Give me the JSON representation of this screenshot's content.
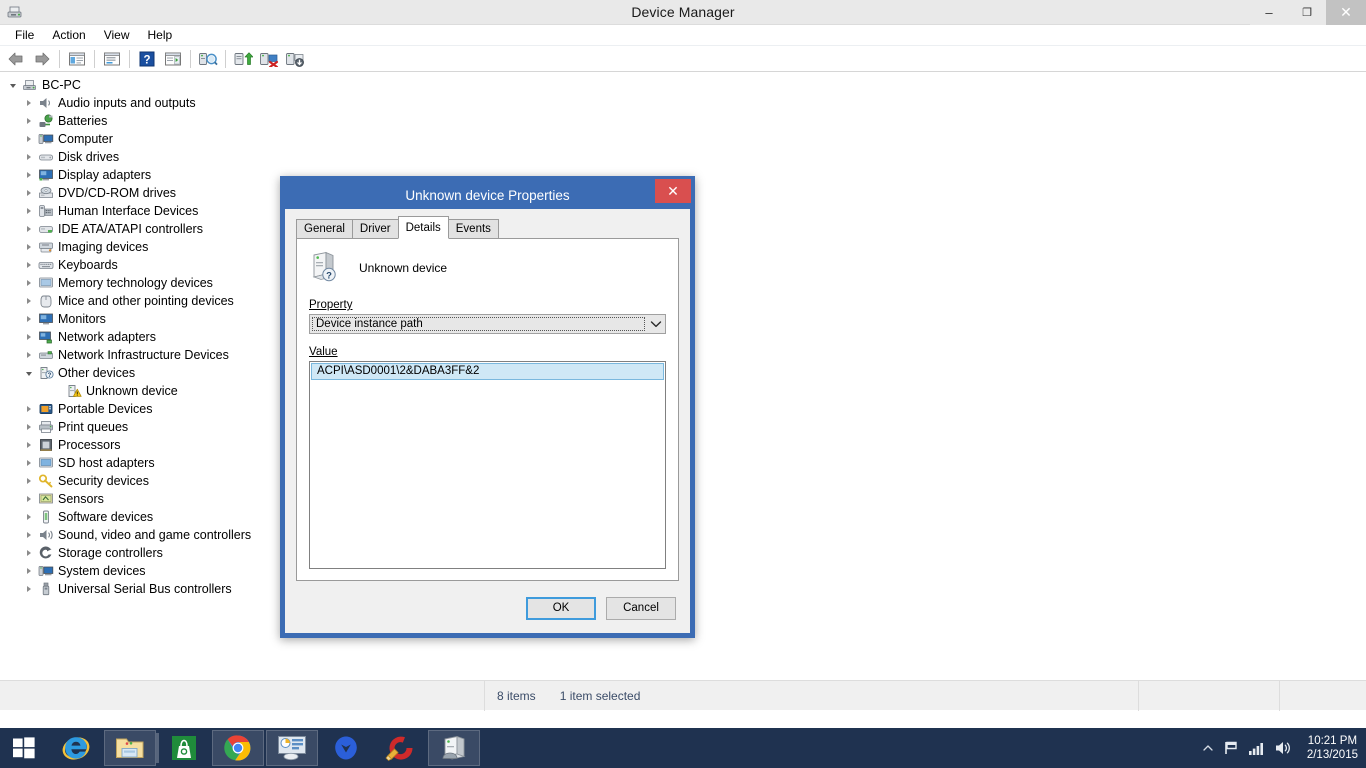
{
  "window": {
    "title": "Device Manager",
    "icon": "device-manager-icon",
    "controls": {
      "minimize": "–",
      "restore": "❐",
      "close": "✕"
    }
  },
  "menubar": {
    "items": [
      "File",
      "Action",
      "View",
      "Help"
    ]
  },
  "toolbar": {
    "buttons": [
      {
        "name": "back-icon"
      },
      {
        "name": "forward-icon"
      },
      {
        "name": "separator"
      },
      {
        "name": "show-hide-console-tree-icon"
      },
      {
        "name": "separator"
      },
      {
        "name": "properties-icon"
      },
      {
        "name": "separator"
      },
      {
        "name": "help-icon"
      },
      {
        "name": "show-hide-action-pane-icon"
      },
      {
        "name": "separator"
      },
      {
        "name": "scan-for-hardware-changes-icon"
      },
      {
        "name": "separator"
      },
      {
        "name": "update-driver-icon"
      },
      {
        "name": "uninstall-device-icon"
      },
      {
        "name": "disable-device-icon"
      }
    ]
  },
  "tree": {
    "root": {
      "label": "BC-PC",
      "icon": "computer-icon",
      "expanded": true
    },
    "items": [
      {
        "label": "Audio inputs and outputs",
        "icon": "speaker-icon",
        "level": 1,
        "expanded": false
      },
      {
        "label": "Batteries",
        "icon": "battery-icon",
        "level": 1,
        "expanded": false
      },
      {
        "label": "Computer",
        "icon": "computer-small-icon",
        "level": 1,
        "expanded": false
      },
      {
        "label": "Disk drives",
        "icon": "disk-drive-icon",
        "level": 1,
        "expanded": false
      },
      {
        "label": "Display adapters",
        "icon": "display-adapter-icon",
        "level": 1,
        "expanded": false
      },
      {
        "label": "DVD/CD-ROM drives",
        "icon": "dvd-drive-icon",
        "level": 1,
        "expanded": false
      },
      {
        "label": "Human Interface Devices",
        "icon": "hid-icon",
        "level": 1,
        "expanded": false
      },
      {
        "label": "IDE ATA/ATAPI controllers",
        "icon": "ide-controller-icon",
        "level": 1,
        "expanded": false
      },
      {
        "label": "Imaging devices",
        "icon": "imaging-device-icon",
        "level": 1,
        "expanded": false
      },
      {
        "label": "Keyboards",
        "icon": "keyboard-icon",
        "level": 1,
        "expanded": false
      },
      {
        "label": "Memory technology devices",
        "icon": "memory-device-icon",
        "level": 1,
        "expanded": false
      },
      {
        "label": "Mice and other pointing devices",
        "icon": "mouse-icon",
        "level": 1,
        "expanded": false
      },
      {
        "label": "Monitors",
        "icon": "monitor-icon",
        "level": 1,
        "expanded": false
      },
      {
        "label": "Network adapters",
        "icon": "network-adapter-icon",
        "level": 1,
        "expanded": false
      },
      {
        "label": "Network Infrastructure Devices",
        "icon": "network-infrastructure-icon",
        "level": 1,
        "expanded": false
      },
      {
        "label": "Other devices",
        "icon": "other-devices-icon",
        "level": 1,
        "expanded": true
      },
      {
        "label": "Unknown device",
        "icon": "unknown-device-warning-icon",
        "level": 2,
        "leaf": true
      },
      {
        "label": "Portable Devices",
        "icon": "portable-device-icon",
        "level": 1,
        "expanded": false
      },
      {
        "label": "Print queues",
        "icon": "printer-icon",
        "level": 1,
        "expanded": false
      },
      {
        "label": "Processors",
        "icon": "processor-icon",
        "level": 1,
        "expanded": false
      },
      {
        "label": "SD host adapters",
        "icon": "sd-host-adapter-icon",
        "level": 1,
        "expanded": false
      },
      {
        "label": "Security devices",
        "icon": "security-device-icon",
        "level": 1,
        "expanded": false
      },
      {
        "label": "Sensors",
        "icon": "sensor-icon",
        "level": 1,
        "expanded": false
      },
      {
        "label": "Software devices",
        "icon": "software-device-icon",
        "level": 1,
        "expanded": false
      },
      {
        "label": "Sound, video and game controllers",
        "icon": "sound-controller-icon",
        "level": 1,
        "expanded": false
      },
      {
        "label": "Storage controllers",
        "icon": "storage-controller-icon",
        "level": 1,
        "expanded": false
      },
      {
        "label": "System devices",
        "icon": "system-device-icon",
        "level": 1,
        "expanded": false
      },
      {
        "label": "Universal Serial Bus controllers",
        "icon": "usb-controller-icon",
        "level": 1,
        "expanded": false
      }
    ]
  },
  "dialog": {
    "title": "Unknown device Properties",
    "close_label": "✕",
    "tabs": [
      {
        "label": "General",
        "active": false
      },
      {
        "label": "Driver",
        "active": false
      },
      {
        "label": "Details",
        "active": true
      },
      {
        "label": "Events",
        "active": false
      }
    ],
    "device_name": "Unknown device",
    "device_icon": "unknown-device-icon",
    "property_label": "Property",
    "property_value": "Device instance path",
    "value_label": "Value",
    "values": [
      "ACPI\\ASD0001\\2&DABA3FF&2"
    ],
    "buttons": {
      "ok": "OK",
      "cancel": "Cancel"
    }
  },
  "explorer_status": {
    "item_count": "8 items",
    "selection": "1 item selected"
  },
  "taskbar": {
    "start_icon": "windows-start-icon",
    "apps": [
      {
        "name": "internet-explorer-icon",
        "running": false
      },
      {
        "name": "file-explorer-icon",
        "running": true,
        "grouped": true
      },
      {
        "name": "windows-store-icon",
        "running": false
      },
      {
        "name": "google-chrome-icon",
        "running": true
      },
      {
        "name": "control-panel-icon",
        "running": true
      },
      {
        "name": "malwarebytes-icon",
        "running": false
      },
      {
        "name": "ccleaner-icon",
        "running": false
      },
      {
        "name": "device-manager-taskbar-icon",
        "running": true
      }
    ],
    "tray": {
      "show_hidden_icon": "chevron-up-icon",
      "action_center_icon": "flag-icon",
      "network_icon": "network-signal-icon",
      "volume_icon": "speaker-volume-icon",
      "time": "10:21 PM",
      "date": "2/13/2015"
    }
  },
  "colors": {
    "dialog_frame": "#3c6cb4",
    "close_red": "#d94f4f",
    "taskbar": "#1f3250",
    "selection_blue": "#cfe8f6",
    "focus_blue": "#3f9bdc"
  }
}
